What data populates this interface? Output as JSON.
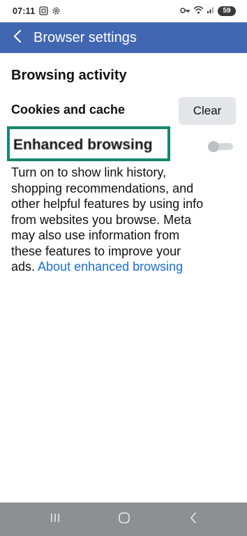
{
  "status_bar": {
    "time": "07:11",
    "battery_level": "59",
    "left_icons": [
      "screenshot-icon",
      "settings-gear-icon"
    ],
    "right_icons": [
      "key-icon",
      "wifi-icon",
      "signal-icon",
      "battery-icon"
    ]
  },
  "app_bar": {
    "back_icon": "chevron-left-icon",
    "title": "Browser settings",
    "color": "#4267b2"
  },
  "content": {
    "section_title": "Browsing activity",
    "cookies": {
      "label": "Cookies and cache",
      "clear_label": "Clear"
    },
    "enhanced": {
      "label": "Enhanced browsing",
      "toggle_on": false,
      "highlight_color": "#16876e"
    },
    "description": {
      "lines": [
        "Turn on to show link history,",
        "shopping recommendations, and",
        "other helpful features by using info",
        "from websites you browse. Meta",
        "may also use information from",
        "these features to improve your"
      ],
      "last_line_prefix": "ads. ",
      "link_text": "About enhanced browsing",
      "link_color": "#1a6ed8"
    }
  },
  "nav_bar": {
    "buttons": [
      "recents-icon",
      "home-icon",
      "back-icon"
    ]
  }
}
